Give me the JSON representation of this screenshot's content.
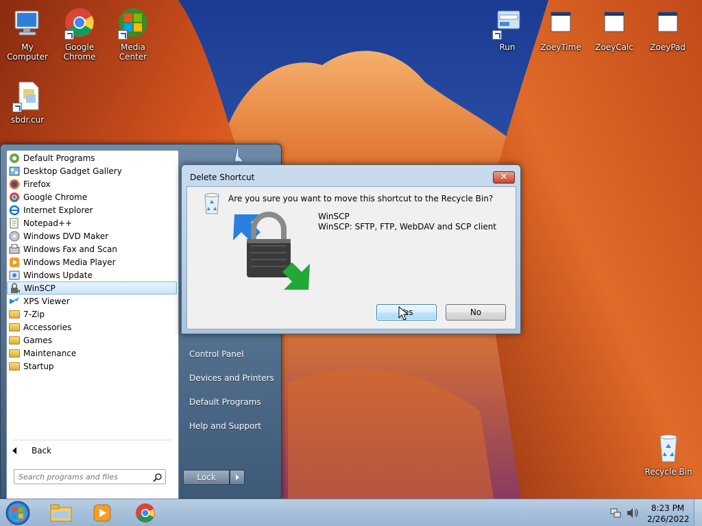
{
  "desktop": {
    "icons": [
      {
        "label": "My Computer",
        "icon": "computer-icon"
      },
      {
        "label": "Google Chrome",
        "icon": "chrome-icon"
      },
      {
        "label": "Media Center",
        "icon": "media-center-icon"
      },
      {
        "label": "sbdr.cur",
        "icon": "cursor-file-icon"
      },
      {
        "label": "Run",
        "icon": "run-icon"
      },
      {
        "label": "ZoeyTime",
        "icon": "app-window-icon"
      },
      {
        "label": "ZoeyCalc",
        "icon": "app-window-icon"
      },
      {
        "label": "ZoeyPad",
        "icon": "app-window-icon"
      },
      {
        "label": "Recycle Bin",
        "icon": "recycle-bin-icon"
      }
    ]
  },
  "start_menu": {
    "programs": [
      {
        "label": "Default Programs",
        "icon": "default-programs-icon"
      },
      {
        "label": "Desktop Gadget Gallery",
        "icon": "gadget-icon"
      },
      {
        "label": "Firefox",
        "icon": "firefox-icon"
      },
      {
        "label": "Google Chrome",
        "icon": "chrome-icon"
      },
      {
        "label": "Internet Explorer",
        "icon": "ie-icon"
      },
      {
        "label": "Notepad++",
        "icon": "notepadpp-icon"
      },
      {
        "label": "Windows DVD Maker",
        "icon": "dvd-icon"
      },
      {
        "label": "Windows Fax and Scan",
        "icon": "fax-icon"
      },
      {
        "label": "Windows Media Player",
        "icon": "media-player-icon"
      },
      {
        "label": "Windows Update",
        "icon": "update-icon"
      },
      {
        "label": "WinSCP",
        "icon": "winscp-icon"
      },
      {
        "label": "XPS Viewer",
        "icon": "xps-icon"
      },
      {
        "label": "7-Zip",
        "icon": "folder-icon"
      },
      {
        "label": "Accessories",
        "icon": "folder-icon"
      },
      {
        "label": "Games",
        "icon": "folder-icon"
      },
      {
        "label": "Maintenance",
        "icon": "folder-icon"
      },
      {
        "label": "Startup",
        "icon": "folder-icon"
      }
    ],
    "selected_program": "WinSCP",
    "back_label": "Back",
    "search_placeholder": "Search programs and files",
    "right_items": [
      "Control Panel",
      "Devices and Printers",
      "Default Programs",
      "Help and Support"
    ],
    "lock_label": "Lock"
  },
  "dialog": {
    "title": "Delete Shortcut",
    "close_label": "✕",
    "question": "Are you sure you want to move this shortcut to the Recycle Bin?",
    "item_name": "WinSCP",
    "item_description": "WinSCP: SFTP, FTP, WebDAV and SCP client",
    "yes_label": "Yes",
    "no_label": "No"
  },
  "taskbar": {
    "apps": [
      "explorer-icon",
      "media-player-icon",
      "chrome-icon"
    ],
    "time": "8:23 PM",
    "date": "2/26/2022"
  },
  "colors": {
    "accent": "#3c7fb1",
    "selection": "#cbe4f8",
    "close_button": "#c5452c"
  }
}
